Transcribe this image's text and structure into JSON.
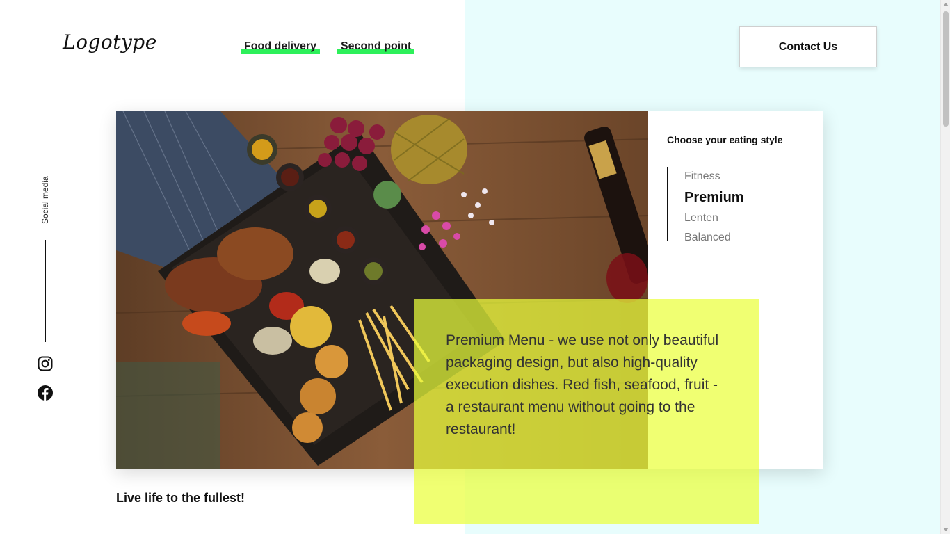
{
  "header": {
    "logo": "Logotype",
    "nav": [
      {
        "label": "Food delivery"
      },
      {
        "label": "Second point"
      }
    ],
    "contact_label": "Contact Us"
  },
  "social": {
    "label": "Social media",
    "icons": [
      "instagram-icon",
      "facebook-icon"
    ]
  },
  "eating_style": {
    "title": "Choose your eating style",
    "options": [
      {
        "label": "Fitness",
        "active": false
      },
      {
        "label": "Premium",
        "active": true
      },
      {
        "label": "Lenten",
        "active": false
      },
      {
        "label": "Balanced",
        "active": false
      }
    ]
  },
  "description": {
    "text": "Premium Menu - we use not only beautiful packaging design, but also high-quality execution dishes. Red fish, seafood, fruit - a restaurant menu without going to the restaurant!"
  },
  "tagline": "Live life to the fullest!",
  "colors": {
    "accent_green": "#2df05a",
    "highlight_yellow": "#eaff3c",
    "right_bg": "#e8fdfd"
  }
}
